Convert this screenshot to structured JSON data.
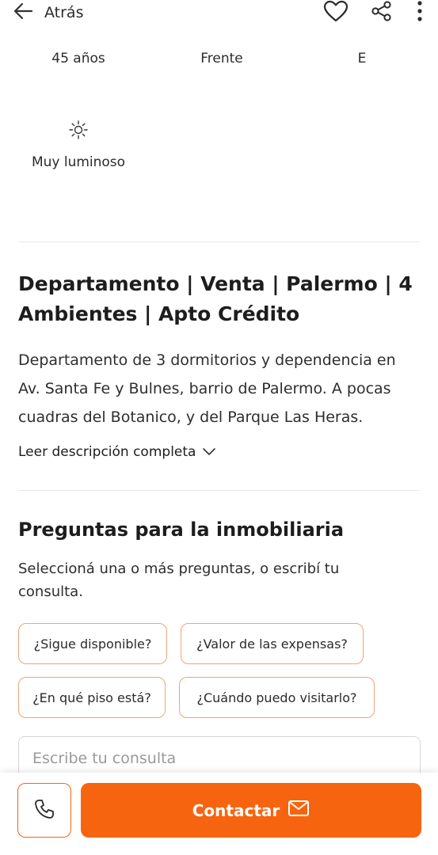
{
  "topbar": {
    "back_label": "Atrás",
    "icons": [
      "arrow-left-icon",
      "heart-icon",
      "share-icon",
      "more-vertical-icon"
    ]
  },
  "features": {
    "row1": [
      "45 años",
      "Frente",
      "E"
    ],
    "luminous_icon": "sun-icon",
    "luminous_label": "Muy luminoso"
  },
  "listing": {
    "title": "Departamento | Venta | Palermo | 4 Ambientes | Apto Crédito",
    "description": "Departamento de 3 dormitorios y dependencia en Av. Santa Fe y Bulnes, barrio de Palermo. A pocas cuadras del Botanico, y del Parque Las Heras.",
    "read_more": "Leer descripción completa"
  },
  "questions": {
    "title": "Preguntas para la inmobiliaria",
    "subtitle": "Seleccioná una o más preguntas, o escribí tu consulta.",
    "chips": [
      "¿Sigue disponible?",
      "¿Valor de las expensas?",
      "¿En qué piso está?",
      "¿Cuándo puedo visitarlo?"
    ],
    "input_placeholder": "Escribe tu consulta"
  },
  "bottom": {
    "contact_label": "Contactar"
  },
  "colors": {
    "accent": "#f7640f",
    "chip_border": "#f0a37a"
  }
}
